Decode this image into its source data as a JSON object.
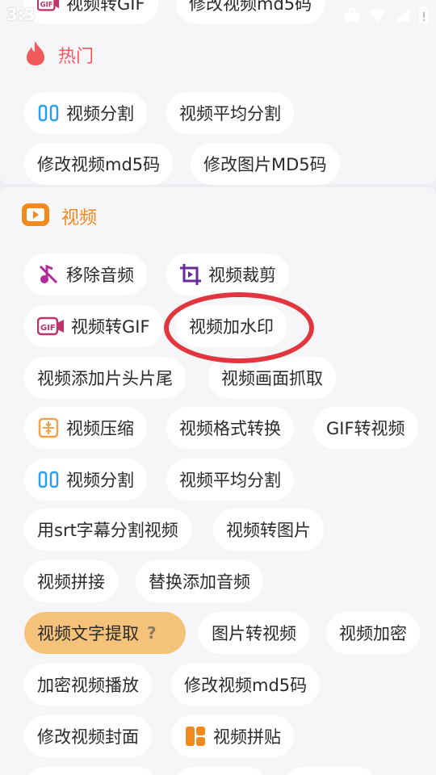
{
  "status": {
    "time": "3:3"
  },
  "hot_section": {
    "partial_items": [
      "视频转GIF",
      "修改视频md5码"
    ],
    "title": "热门",
    "items": [
      "视频分割",
      "视频平均分割",
      "修改视频md5码",
      "修改图片MD5码"
    ]
  },
  "video_section": {
    "title": "视频",
    "items": [
      {
        "label": "移除音频",
        "icon": "mute-music-icon"
      },
      {
        "label": "视频裁剪",
        "icon": "crop-icon"
      },
      {
        "label": "视频转GIF",
        "icon": "gif-icon"
      },
      {
        "label": "视频加水印"
      },
      {
        "label": "视频添加片头片尾"
      },
      {
        "label": "视频画面抓取"
      },
      {
        "label": "视频压缩",
        "icon": "compress-icon"
      },
      {
        "label": "视频格式转换"
      },
      {
        "label": "GIF转视频"
      },
      {
        "label": "视频分割",
        "icon": "split-icon"
      },
      {
        "label": "视频平均分割"
      },
      {
        "label": "用srt字幕分割视频"
      },
      {
        "label": "视频转图片"
      },
      {
        "label": "视频拼接"
      },
      {
        "label": "替换添加音频"
      },
      {
        "label": "视频文字提取",
        "help": "?"
      },
      {
        "label": "图片转视频"
      },
      {
        "label": "视频加密"
      },
      {
        "label": "加密视频播放"
      },
      {
        "label": "修改视频md5码"
      },
      {
        "label": "修改视频封面"
      },
      {
        "label": "视频拼贴",
        "icon": "collage-icon"
      }
    ]
  },
  "colors": {
    "hot_accent": "#f05a5a",
    "video_accent": "#f08a1e",
    "highlight_chip": "#f5c27a",
    "annotation": "#e2363f",
    "split_icon": "#2a9ff0",
    "gif_icon": "#c0326a",
    "mute_icon": "#b02a9a",
    "crop_icon": "#6a2a9a"
  }
}
